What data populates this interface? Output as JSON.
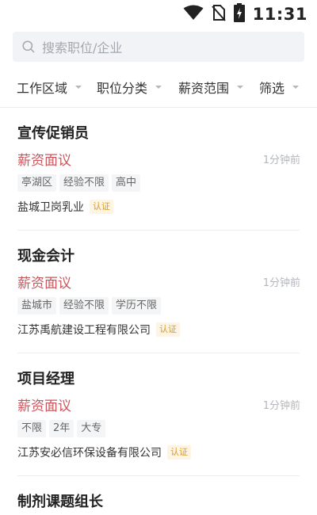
{
  "status_bar": {
    "time": "11:31",
    "icons": [
      "wifi-icon",
      "no-sim-icon",
      "battery-charging-icon"
    ]
  },
  "search": {
    "placeholder": "搜索职位/企业"
  },
  "filters": [
    {
      "label": "工作区域"
    },
    {
      "label": "职位分类"
    },
    {
      "label": "薪资范围"
    },
    {
      "label": "筛选"
    }
  ],
  "jobs": [
    {
      "title": "宣传促销员",
      "salary": "薪资面议",
      "time": "1分钟前",
      "tags": [
        "亭湖区",
        "经验不限",
        "高中"
      ],
      "company": "盐城卫岗乳业",
      "verified": "认证"
    },
    {
      "title": "现金会计",
      "salary": "薪资面议",
      "time": "1分钟前",
      "tags": [
        "盐城市",
        "经验不限",
        "学历不限"
      ],
      "company": "江苏禹航建设工程有限公司",
      "verified": "认证"
    },
    {
      "title": "项目经理",
      "salary": "薪资面议",
      "time": "1分钟前",
      "tags": [
        "不限",
        "2年",
        "大专"
      ],
      "company": "江苏安必信环保设备有限公司",
      "verified": "认证"
    },
    {
      "title": "制剂课题组长"
    }
  ],
  "colors": {
    "salary": "#c9565c",
    "badge_text": "#d89a30",
    "badge_bg": "#fdf4e3",
    "search_bg": "#f2f3f6"
  }
}
